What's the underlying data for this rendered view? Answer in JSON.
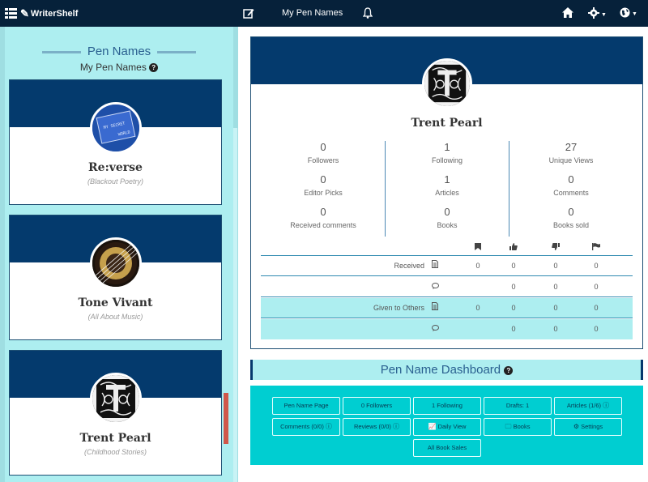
{
  "app": {
    "logo_text": "WriterShelf",
    "nav_title": "My Pen Names"
  },
  "left_panel": {
    "title": "Pen Names",
    "subtitle": "My Pen Names",
    "cards": [
      {
        "name": "Re:verse",
        "genre": "(Blackout Poetry)",
        "avatar_text_top": "MY SECRET",
        "avatar_text_bottom": "WORLD"
      },
      {
        "name": "Tone Vivant",
        "genre": "(All About Music)"
      },
      {
        "name": "Trent Pearl",
        "genre": "(Childhood Stories)"
      }
    ]
  },
  "profile": {
    "name": "Trent Pearl",
    "stats": {
      "col1": [
        {
          "value": "0",
          "label": "Followers"
        },
        {
          "value": "0",
          "label": "Editor Picks"
        },
        {
          "value": "0",
          "label": "Received comments"
        }
      ],
      "col2": [
        {
          "value": "1",
          "label": "Following"
        },
        {
          "value": "1",
          "label": "Articles"
        },
        {
          "value": "0",
          "label": "Books"
        }
      ],
      "col3": [
        {
          "value": "27",
          "label": "Unique Views"
        },
        {
          "value": "0",
          "label": "Comments"
        },
        {
          "value": "0",
          "label": "Books sold"
        }
      ]
    },
    "summary": {
      "rows": [
        {
          "label": "Received",
          "v1": "0",
          "v2": "0",
          "v3": "0",
          "v4": "0"
        },
        {
          "label": "",
          "v1": "",
          "v2": "0",
          "v3": "0",
          "v4": "0"
        },
        {
          "label": "Given to Others",
          "v1": "0",
          "v2": "0",
          "v3": "0",
          "v4": "0"
        },
        {
          "label": "",
          "v1": "",
          "v2": "0",
          "v3": "0",
          "v4": "0"
        }
      ]
    }
  },
  "dashboard": {
    "title": "Pen Name Dashboard",
    "buttons": {
      "pen_name_page": "Pen Name Page",
      "followers": "0 Followers",
      "following": "1 Following",
      "drafts": "Drafts: 1",
      "articles": "Articles (1/6)",
      "comments": "Comments (0/0)",
      "reviews": "Reviews (0/0)",
      "daily_view": "Daily View",
      "books": "Books",
      "settings": "Settings",
      "all_book_sales": "All Book Sales"
    }
  },
  "colors": {
    "navbar": "#06213a",
    "banner": "#043a6d",
    "panel_bg": "#adeef0",
    "dashboard_bg": "#00ced1",
    "scroll_thumb": "#d0574a"
  }
}
